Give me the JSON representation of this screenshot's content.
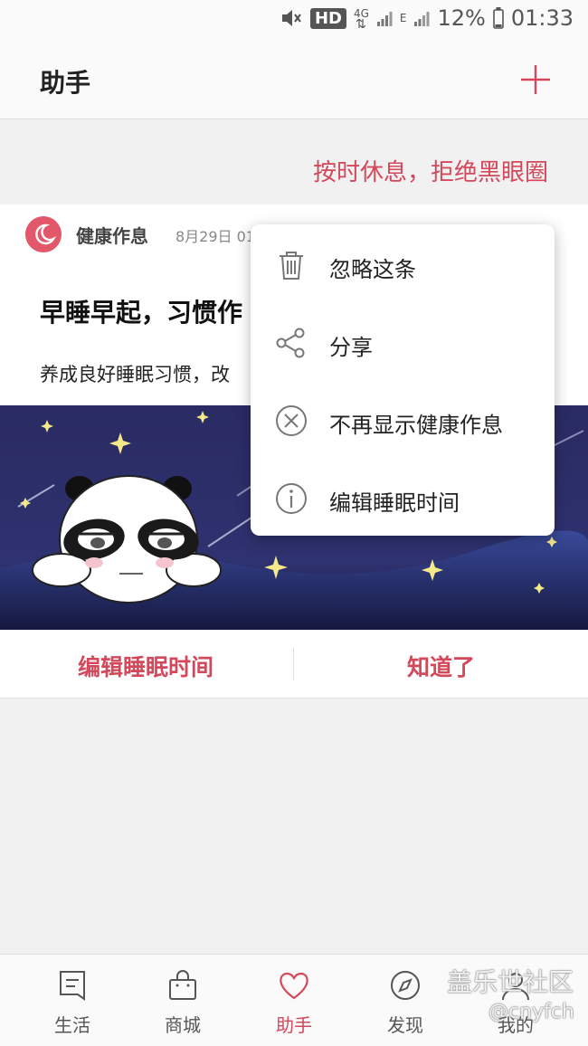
{
  "status_bar": {
    "hd": "HD",
    "network_4g": "4G",
    "network_e": "E",
    "battery": "12%",
    "time": "01:33"
  },
  "header": {
    "title": "助手",
    "add_icon": "plus-icon"
  },
  "banner": {
    "text": "按时休息，拒绝黑眼圈"
  },
  "card": {
    "source": "健康作息",
    "date": "8月29日 01",
    "title": "早睡早起，习惯作",
    "desc": "养成良好睡眠习惯，改",
    "actions": {
      "edit": "编辑睡眠时间",
      "ok": "知道了"
    }
  },
  "popup": {
    "items": [
      {
        "label": "忽略这条",
        "icon": "trash-icon"
      },
      {
        "label": "分享",
        "icon": "share-icon"
      },
      {
        "label": "不再显示健康作息",
        "icon": "close-circle-icon"
      },
      {
        "label": "编辑睡眠时间",
        "icon": "info-icon"
      }
    ]
  },
  "bottom_nav": {
    "items": [
      {
        "label": "生活",
        "icon": "bookmark-icon"
      },
      {
        "label": "商城",
        "icon": "shopping-bag-icon"
      },
      {
        "label": "助手",
        "icon": "heart-icon",
        "active": true
      },
      {
        "label": "发现",
        "icon": "compass-icon"
      },
      {
        "label": "我的",
        "icon": "user-icon"
      }
    ]
  },
  "watermark": {
    "text": "盖乐世社区",
    "sub": "@cnyfch"
  },
  "colors": {
    "accent": "#d3485a",
    "night_sky": "#2c2e66"
  }
}
